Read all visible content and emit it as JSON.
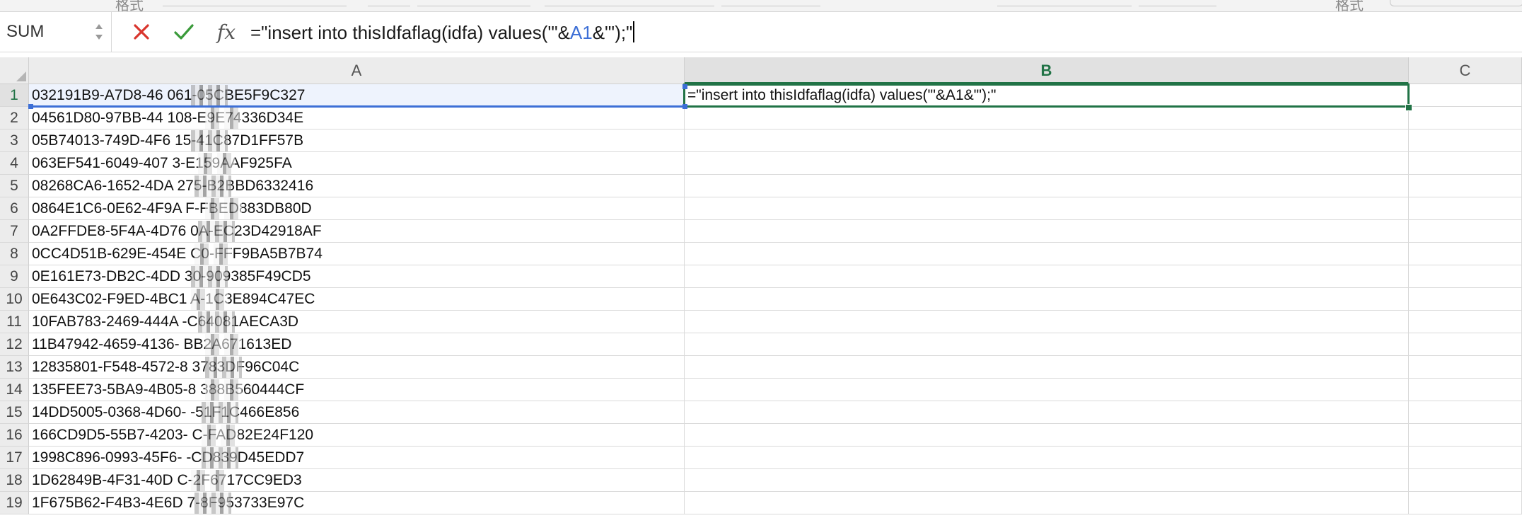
{
  "ribbon": {
    "partial_label_left": "格式",
    "partial_label_right": "格式"
  },
  "formula_bar": {
    "name_box_value": "SUM",
    "cancel_icon": "cross-icon",
    "enter_icon": "check-icon",
    "function_icon": "fx-icon",
    "fx_label": "fx",
    "formula_parts": {
      "before_ref": "=\"insert into thisIdfaflag(idfa) values('\"&",
      "ref": "A1",
      "after_ref": "&\"');\""
    }
  },
  "columns": [
    "A",
    "B",
    "C"
  ],
  "active_column": "B",
  "rows": [
    {
      "n": "1",
      "a": "032191B9-A7D8-46   061-05CBE5F9C327"
    },
    {
      "n": "2",
      "a": "04561D80-97BB-44   108-E9E74336D34E"
    },
    {
      "n": "3",
      "a": "05B74013-749D-4F6   15-41C87D1FF57B"
    },
    {
      "n": "4",
      "a": "063EF541-6049-407   3-E159AAF925FA"
    },
    {
      "n": "5",
      "a": "08268CA6-1652-4DA   275-B2BBD6332416"
    },
    {
      "n": "6",
      "a": "0864E1C6-0E62-4F9A   F-FBED883DB80D"
    },
    {
      "n": "7",
      "a": "0A2FFDE8-5F4A-4D76   0A-EC23D42918AF"
    },
    {
      "n": "8",
      "a": "0CC4D51B-629E-454E   C0-FFF9BA5B7B74"
    },
    {
      "n": "9",
      "a": "0E161E73-DB2C-4DD   30-909385F49CD5"
    },
    {
      "n": "10",
      "a": "0E643C02-F9ED-4BC1   A-1C3E894C47EC"
    },
    {
      "n": "11",
      "a": "10FAB783-2469-444A   -C64081AECA3D"
    },
    {
      "n": "12",
      "a": "11B47942-4659-4136-   BB2A671613ED"
    },
    {
      "n": "13",
      "a": "12835801-F548-4572-8   3783DF96C04C"
    },
    {
      "n": "14",
      "a": "135FEE73-5BA9-4B05-8   388B560444CF"
    },
    {
      "n": "15",
      "a": "14DD5005-0368-4D60-   -51F1C466E856"
    },
    {
      "n": "16",
      "a": "166CD9D5-55B7-4203-   C-FAD82E24F120"
    },
    {
      "n": "17",
      "a": "1998C896-0993-45F6-   -CD839D45EDD7"
    },
    {
      "n": "18",
      "a": "1D62849B-4F31-40D   C-2F6717CC9ED3"
    },
    {
      "n": "19",
      "a": "1F675B62-F4B3-4E6D   7-8F953733E97C"
    }
  ],
  "b1_display": "=\"insert into thisIdfaflag(idfa) values('\"&A1&\"');\""
}
